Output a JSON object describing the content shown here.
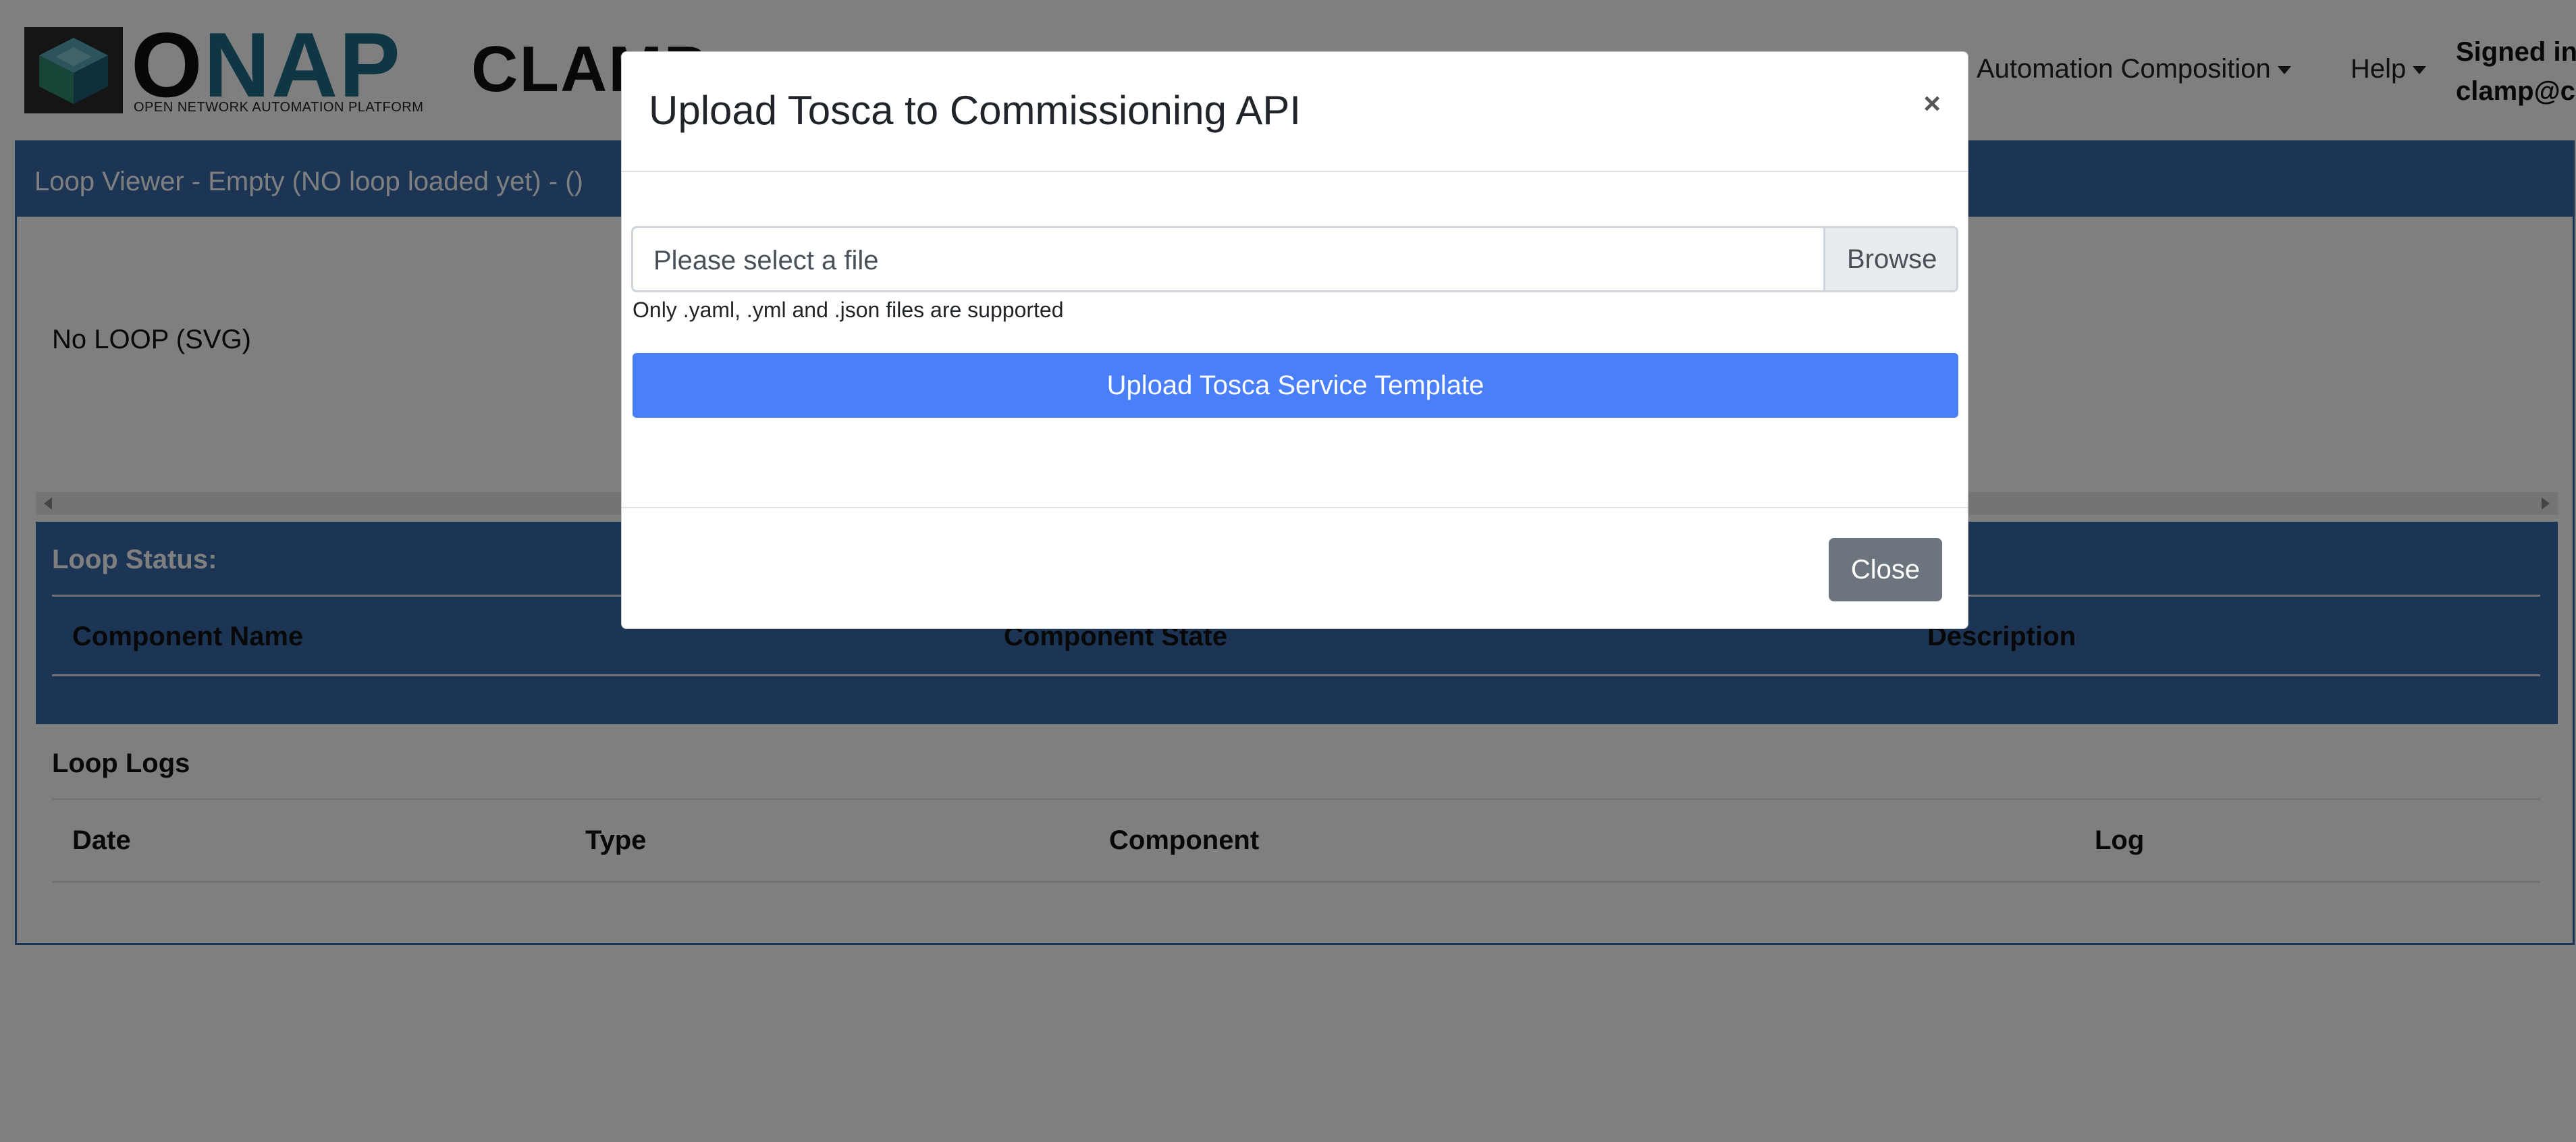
{
  "header": {
    "logo_word_prefix": "O",
    "logo_word_rest": "NAP",
    "logo_subtitle": "OPEN NETWORK AUTOMATION PLATFORM",
    "app_title": "CLAMP",
    "menu_automation": "Automation Composition",
    "menu_help": "Help",
    "signed_in_line1": "Signed in",
    "signed_in_line2": "clamp@c"
  },
  "loop_viewer": {
    "title": "Loop Viewer - Empty (NO loop loaded yet) - ()",
    "svg_placeholder": "No LOOP (SVG)"
  },
  "loop_status": {
    "title": "Loop Status:",
    "columns": [
      "Component Name",
      "Component State",
      "Description"
    ]
  },
  "loop_logs": {
    "title": "Loop Logs",
    "columns": [
      "Date",
      "Type",
      "Component",
      "Log"
    ]
  },
  "modal": {
    "title": "Upload Tosca to Commissioning API",
    "close_x": "×",
    "file_placeholder": "Please select a file",
    "browse_label": "Browse",
    "help_text": "Only .yaml, .yml and .json files are supported",
    "upload_button": "Upload Tosca Service Template",
    "close_button": "Close"
  },
  "colors": {
    "primary_header": "#3b6aa8",
    "upload_button": "#4a7ffa",
    "close_button": "#6c757d",
    "logo_accent": "#1f6f86"
  }
}
